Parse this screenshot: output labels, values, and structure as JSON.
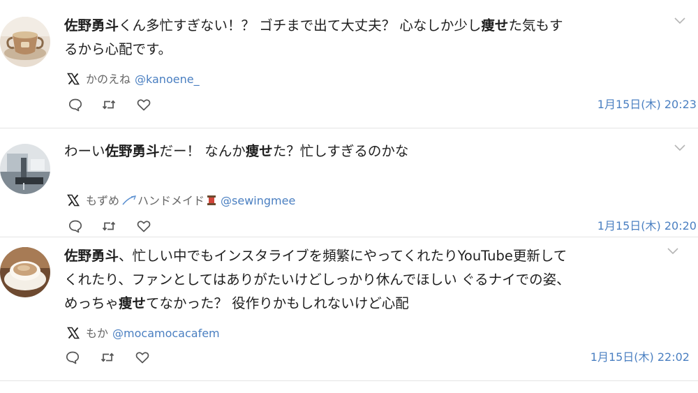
{
  "posts": [
    {
      "text_segments": [
        "",
        "佐野勇斗",
        "くん多忙すぎない！？ ゴチまで出て大丈夫？ 心なしか少し",
        "痩せ",
        "た気もす",
        "るから心配です。"
      ],
      "author": {
        "name": "かのえね",
        "handle": "@kanoene_"
      },
      "timestamp": "1月15日(木) 20:23",
      "avatar_icon": "teacup-avatar-icon"
    },
    {
      "text_segments": [
        "わーい",
        "佐野勇斗",
        "だー！ なんか",
        "痩せ",
        "た？忙しすぎるのかな"
      ],
      "author": {
        "name": "もずめ",
        "name_suffix": "ハンドメイド",
        "handle": "@sewingmee"
      },
      "timestamp": "1月15日(木) 20:20",
      "avatar_icon": "sewing-machine-avatar-icon"
    },
    {
      "text_segments": [
        "佐野勇斗",
        "、忙しい中でもインスタライブを頻繁にやってくれたりYouTube更新して",
        "くれたり、ファンとしてはありがたいけどしっかり休んでほしい ぐるナイでの姿、",
        "めっちゃ",
        "痩せ",
        "てなかった？ 役作りかもしれないけど心配"
      ],
      "author": {
        "name": "もか",
        "handle": "@mocamocacafem"
      },
      "timestamp": "1月15日(木) 22:02",
      "avatar_icon": "coffee-cup-avatar-icon"
    }
  ],
  "colors": {
    "link": "#4a7fc1",
    "text": "#1e1e1e",
    "muted": "#666666",
    "icon": "#555555",
    "divider": "#e4e4e4"
  },
  "icons": [
    "x-logo-icon",
    "reply-icon",
    "repost-icon",
    "like-icon",
    "chevron-down-icon",
    "needle-icon",
    "spool-icon"
  ]
}
